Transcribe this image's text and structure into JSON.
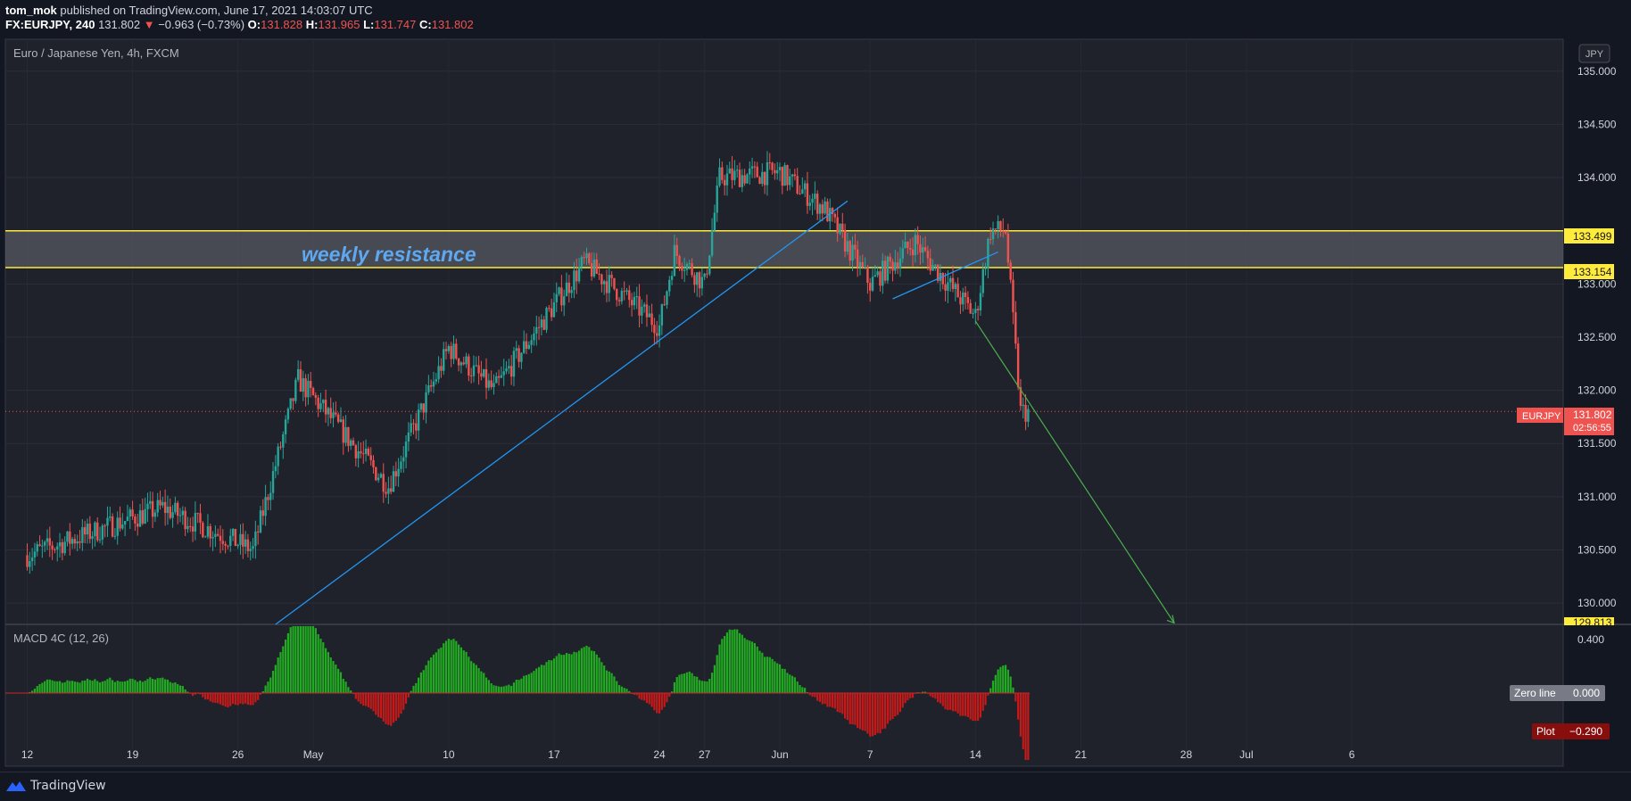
{
  "header": {
    "author": "tom_mok",
    "published": "published on TradingView.com, June 17, 2021 14:03:07 UTC",
    "symbol": "FX:EURJPY, 240",
    "price": "131.802",
    "arrow": "▼",
    "change": "−0.963 (−0.73%)",
    "o_label": "O:",
    "o": "131.828",
    "h_label": "H:",
    "h": "131.965",
    "l_label": "L:",
    "l": "131.747",
    "c_label": "C:",
    "c": "131.802"
  },
  "pane": {
    "title": "Euro / Japanese Yen, 4h, FXCM",
    "currency": "JPY",
    "annotation": "weekly resistance"
  },
  "price_scale": {
    "ticks": [
      "135.000",
      "134.500",
      "134.000",
      "133.000",
      "132.500",
      "132.000",
      "131.500",
      "131.000",
      "130.500",
      "130.000"
    ],
    "tags": {
      "upper": "133.499",
      "lower": "133.154",
      "symbol": "EURJPY",
      "last": "131.802",
      "countdown": "02:56:55",
      "target": "129.813"
    }
  },
  "time_axis": {
    "labels": [
      "12",
      "19",
      "26",
      "May",
      "10",
      "17",
      "24",
      "27",
      "Jun",
      "7",
      "14",
      "21",
      "28",
      "Jul",
      "6"
    ]
  },
  "macd": {
    "title": "MACD 4C (12, 26)",
    "tick_top": "0.400",
    "zero_label": "Zero line",
    "zero_value": "0.000",
    "plot_label": "Plot",
    "plot_value": "−0.290"
  },
  "footer": {
    "brand": "TradingView"
  },
  "colors": {
    "background": "#131722",
    "up": "#26a69a",
    "down": "#ef5350",
    "zone_line": "#ffeb3b",
    "zone_fill": "#787b86",
    "trend": "#2196f3",
    "projection": "#4caf50",
    "macd_up": "#22ab22",
    "macd_down": "#c41a1a"
  },
  "chart_data": {
    "type": "candlestick",
    "symbol": "EURJPY",
    "timeframe": "4h",
    "ylim": [
      129.8,
      135.3
    ],
    "ohlc": [
      [
        "131.828",
        "131.965",
        "131.747",
        "131.802"
      ]
    ],
    "last_price": 131.802,
    "resistance_zone": [
      133.154,
      133.499
    ],
    "projection_target": 129.813,
    "anchors": [
      {
        "date": "Apr 12",
        "price": 130.45
      },
      {
        "date": "Apr 21",
        "price": 130.9
      },
      {
        "date": "Apr 27",
        "price": 130.5
      },
      {
        "date": "Apr 30",
        "price": 132.1
      },
      {
        "date": "May 6",
        "price": 131.1
      },
      {
        "date": "May 10",
        "price": 132.4
      },
      {
        "date": "May 13",
        "price": 132.0
      },
      {
        "date": "May 17",
        "price": 132.8
      },
      {
        "date": "May 19",
        "price": 133.2
      },
      {
        "date": "May 24",
        "price": 132.6
      },
      {
        "date": "May 25",
        "price": 133.3
      },
      {
        "date": "May 27",
        "price": 133.0
      },
      {
        "date": "May 28",
        "price": 134.0
      },
      {
        "date": "Jun 1",
        "price": 134.05
      },
      {
        "date": "Jun 4",
        "price": 133.7
      },
      {
        "date": "Jun 7",
        "price": 133.0
      },
      {
        "date": "Jun 10",
        "price": 133.4
      },
      {
        "date": "Jun 11",
        "price": 133.2
      },
      {
        "date": "Jun 14",
        "price": 132.7
      },
      {
        "date": "Jun 15",
        "price": 133.5
      },
      {
        "date": "Jun 16",
        "price": 133.5
      },
      {
        "date": "Jun 17",
        "price": 131.8
      }
    ]
  }
}
